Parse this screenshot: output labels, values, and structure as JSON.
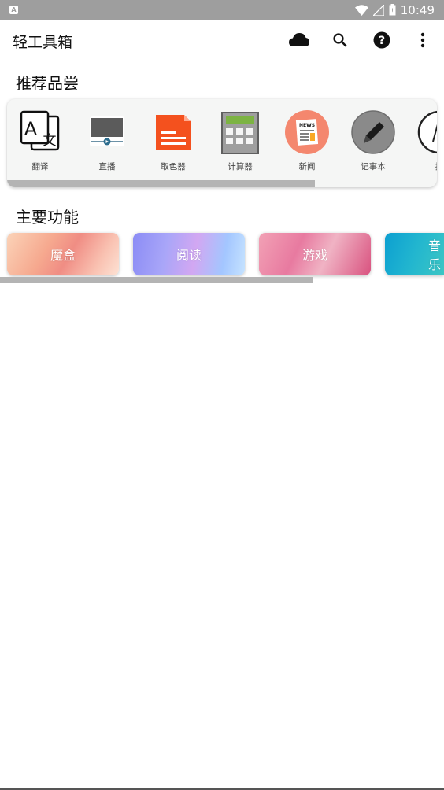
{
  "status_bar": {
    "app_indicator": "A",
    "time": "10:49",
    "icons": [
      "wifi-icon",
      "signal-icon",
      "battery-icon"
    ]
  },
  "app_bar": {
    "title": "轻工具箱",
    "actions": [
      "cloud-icon",
      "search-icon",
      "help-icon",
      "more-vert-icon"
    ]
  },
  "recommend": {
    "title": "推荐品尝",
    "items": [
      {
        "label": "翻译",
        "icon": "translate-icon"
      },
      {
        "label": "直播",
        "icon": "live-tv-icon"
      },
      {
        "label": "取色器",
        "icon": "color-picker-icon"
      },
      {
        "label": "计算器",
        "icon": "calculator-icon"
      },
      {
        "label": "新闻",
        "icon": "news-icon"
      },
      {
        "label": "记事本",
        "icon": "notepad-icon"
      },
      {
        "label": "指",
        "icon": "compass-icon"
      }
    ],
    "news_badge": "NEWS"
  },
  "main": {
    "title": "主要功能",
    "tiles": [
      {
        "label": "魔盒"
      },
      {
        "label": "阅读"
      },
      {
        "label": "游戏"
      },
      {
        "label": "音乐"
      }
    ]
  },
  "colors": {
    "status_bar": "#9e9e9e",
    "card_bg": "#f5f6f5",
    "color_picker": "#f4511e",
    "news_circle": "#f4876e",
    "notepad_circle": "#8a8a8a"
  }
}
